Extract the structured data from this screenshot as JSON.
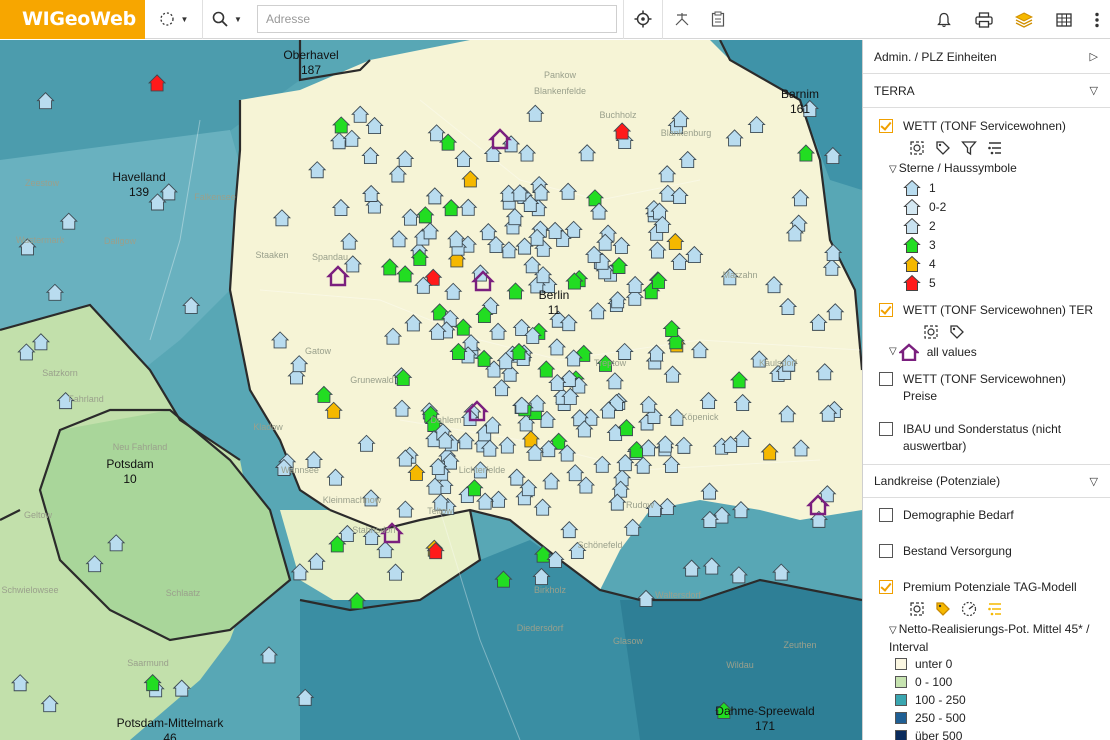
{
  "app": {
    "logo": "WIGeoWeb"
  },
  "toolbar": {
    "search_placeholder": "Adresse",
    "icons": [
      "lasso-select-icon",
      "search-icon",
      "locate-icon",
      "measure-icon",
      "clipboard-icon",
      "bell-icon",
      "print-icon",
      "layers-icon",
      "table-icon",
      "more-icon"
    ]
  },
  "map": {
    "regions": [
      {
        "name": "Oberhavel",
        "code": "187"
      },
      {
        "name": "Barnim",
        "code": "161"
      },
      {
        "name": "Havelland",
        "code": "139"
      },
      {
        "name": "Berlin",
        "code": "11"
      },
      {
        "name": "Potsdam",
        "code": "10"
      },
      {
        "name": "Potsdam-Mittelmark",
        "code": "46"
      },
      {
        "name": "Dahme-Spreewald",
        "code": "171"
      }
    ],
    "place_names": [
      "Spandau",
      "Falkensee",
      "Zeestow",
      "Wustermark",
      "Dallgow",
      "Staaken",
      "Gatow",
      "Kladow",
      "Grunewald",
      "Dahlem",
      "Wannsee",
      "Stahnsdorf",
      "Kleinmachnow",
      "Teltow",
      "Lichterfelde",
      "Schönefeld",
      "Rudow",
      "Treptow",
      "Köpenick",
      "Kaulsdorf",
      "Marzahn",
      "Pankow",
      "Buchholz",
      "Blankenburg",
      "Blankenfelde",
      "Schwielowsee",
      "Saarmund",
      "Diedersdorf",
      "Glasow",
      "Birkholz",
      "Waltersdorf",
      "Satzkorn",
      "Fahrland",
      "Neu Fahrland",
      "Geltow",
      "Schlaatz",
      "Zeuthen",
      "Wildau"
    ]
  },
  "panel": {
    "sections": [
      {
        "title": "Admin. / PLZ Einheiten",
        "arrow": "right"
      },
      {
        "title": "TERRA",
        "arrow": "down"
      }
    ],
    "layer1": {
      "label": "WETT (TONF Servicewohnen)",
      "checked": true,
      "legend_title": "Sterne / Haussymbole",
      "legend": [
        {
          "label": "1",
          "color": "#b9dcef"
        },
        {
          "label": "0-2",
          "color": "#d4e8f2"
        },
        {
          "label": "2",
          "color": "#c9e2f0"
        },
        {
          "label": "3",
          "color": "#22dd22"
        },
        {
          "label": "4",
          "color": "#f5b800"
        },
        {
          "label": "5",
          "color": "#ff1a1a"
        }
      ]
    },
    "layer2": {
      "label": "WETT (TONF Servicewohnen) TER",
      "checked": true,
      "legend_label": "all values",
      "color": "#7a1f7e"
    },
    "layer3": {
      "label": "WETT (TONF Servicewohnen) Preise",
      "checked": false
    },
    "layer4": {
      "label": "IBAU und Sonderstatus (nicht auswertbar)",
      "checked": false
    },
    "section_landkreise": {
      "title": "Landkreise (Potenziale)",
      "arrow": "down"
    },
    "layer5": {
      "label": "Demographie Bedarf",
      "checked": false
    },
    "layer6": {
      "label": "Bestand Versorgung",
      "checked": false
    },
    "layer7": {
      "label": "Premium Potenziale TAG-Modell",
      "checked": true,
      "legend_title": "Netto-Realisierungs-Pot. Mittel 45* / Interval",
      "legend": [
        {
          "label": "unter 0",
          "color": "#fbf7e2"
        },
        {
          "label": "0 - 100",
          "color": "#c6e3b0"
        },
        {
          "label": "100 - 250",
          "color": "#3aa6b0"
        },
        {
          "label": "250 - 500",
          "color": "#1f5f94"
        },
        {
          "label": "über 500",
          "color": "#0a2b5c"
        }
      ]
    }
  }
}
